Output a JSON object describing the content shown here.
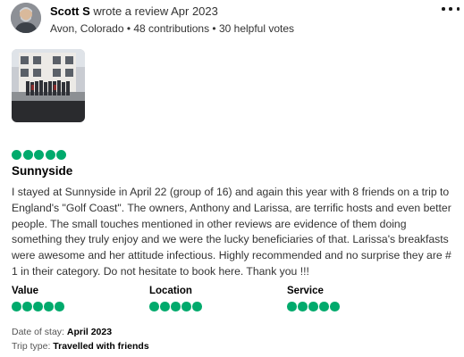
{
  "reviewer": {
    "name": "Scott S",
    "action": " wrote a review Apr 2023",
    "meta": "Avon, Colorado • 48 contributions • 30 helpful votes"
  },
  "icons": {
    "more": "more-options-icon",
    "bubble": "rating-bubble-icon"
  },
  "colors": {
    "rating_green": "#00aa6c"
  },
  "review": {
    "rating": 5,
    "max_rating": 5,
    "title": "Sunnyside",
    "text": "I stayed at Sunnyside in April 22 (group of 16) and again this year with 8 friends on a trip to England's \"Golf Coast\". The owners, Anthony and Larissa, are terrific hosts and even better people. The small touches mentioned in other reviews are evidence of them doing something they truly enjoy and we were the lucky beneficiaries of that. Larissa's breakfasts were awesome and her attitude infectious. Highly recommended and no surprise they are # 1 in their category. Do not hesitate to book here. Thank you !!!"
  },
  "subratings": [
    {
      "label": "Value",
      "rating": 5
    },
    {
      "label": "Location",
      "rating": 5
    },
    {
      "label": "Service",
      "rating": 5
    }
  ],
  "details": {
    "date_label": "Date of stay: ",
    "date_value": "April 2023",
    "trip_label": "Trip type: ",
    "trip_value": "Travelled with friends"
  }
}
